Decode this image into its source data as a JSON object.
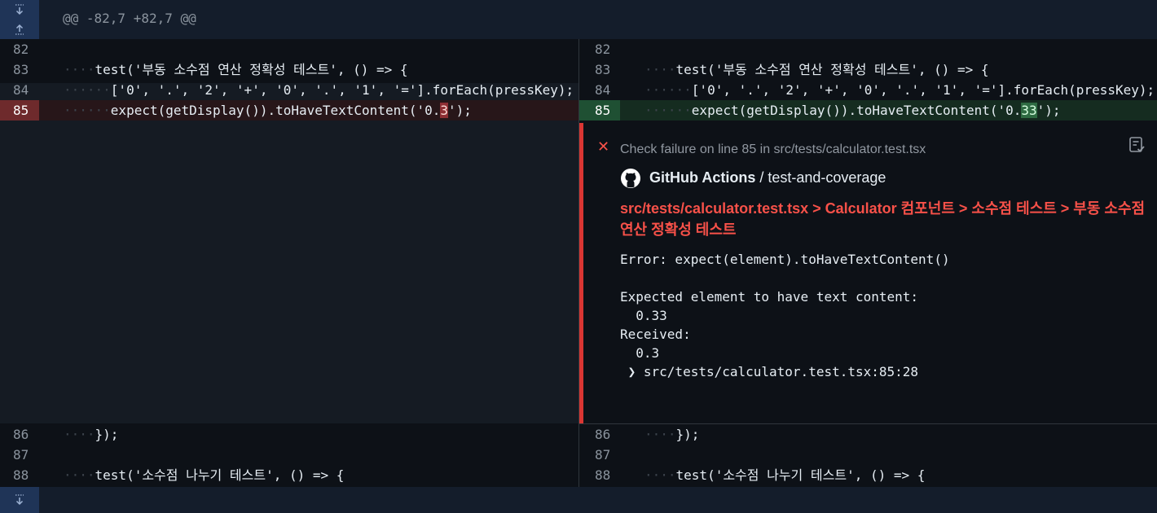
{
  "hunk": {
    "header": "@@ -82,7 +82,7 @@",
    "expand_down_icon": "unfold-down-icon",
    "expand_up_icon": "unfold-up-icon"
  },
  "left": {
    "lines": [
      {
        "num": "82",
        "ws": "",
        "code": ""
      },
      {
        "num": "83",
        "ws": "····",
        "code": "test('부동 소수점 연산 정확성 테스트', () => {"
      },
      {
        "num": "84",
        "ws": "······",
        "code": "['0', '.', '2', '+', '0', '.', '1', '='].forEach(pressKey);"
      },
      {
        "num": "85",
        "ws": "······",
        "code_pre": "expect(getDisplay()).toHaveTextContent('0.",
        "code_hl": "3",
        "code_post": "');"
      },
      {
        "num": "86",
        "ws": "····",
        "code": "});"
      },
      {
        "num": "87",
        "ws": "",
        "code": ""
      },
      {
        "num": "88",
        "ws": "····",
        "code": "test('소수점 나누기 테스트', () => {"
      }
    ]
  },
  "right": {
    "lines": [
      {
        "num": "82",
        "ws": "",
        "code": ""
      },
      {
        "num": "83",
        "ws": "····",
        "code": "test('부동 소수점 연산 정확성 테스트', () => {"
      },
      {
        "num": "84",
        "ws": "······",
        "code": "['0', '.', '2', '+', '0', '.', '1', '='].forEach(pressKey);"
      },
      {
        "num": "85",
        "ws": "······",
        "code_pre": "expect(getDisplay()).toHaveTextContent('0.",
        "code_hl": "33",
        "code_post": "');"
      },
      {
        "num": "86",
        "ws": "····",
        "code": "});"
      },
      {
        "num": "87",
        "ws": "",
        "code": ""
      },
      {
        "num": "88",
        "ws": "····",
        "code": "test('소수점 나누기 테스트', () => {"
      }
    ]
  },
  "annotation": {
    "header": "Check failure on line 85 in src/tests/calculator.test.tsx",
    "app_name": "GitHub Actions",
    "separator": " / ",
    "job_name": "test-and-coverage",
    "test_path": "src/tests/calculator.test.tsx > Calculator 컴포넌트 > 소수점 테스트 > 부동 소수점 연산 정확성 테스트",
    "message": "Error: expect(element).toHaveTextContent()\n\nExpected element to have text content:\n  0.33\nReceived:\n  0.3\n ❯ src/tests/calculator.test.tsx:85:28",
    "icons": {
      "status": "x-icon",
      "logo": "github-logo-icon",
      "action": "checklist-icon"
    }
  },
  "colors": {
    "background": "#0d1117",
    "deletion_bg": "#271619",
    "deletion_num_bg": "#6e2a2c",
    "addition_bg": "#152c20",
    "addition_num_bg": "#1f5033",
    "error": "#f85149",
    "annotation_bar": "#da3633",
    "hunk_bg": "#141d2b",
    "expander_bg": "#1f3457"
  }
}
